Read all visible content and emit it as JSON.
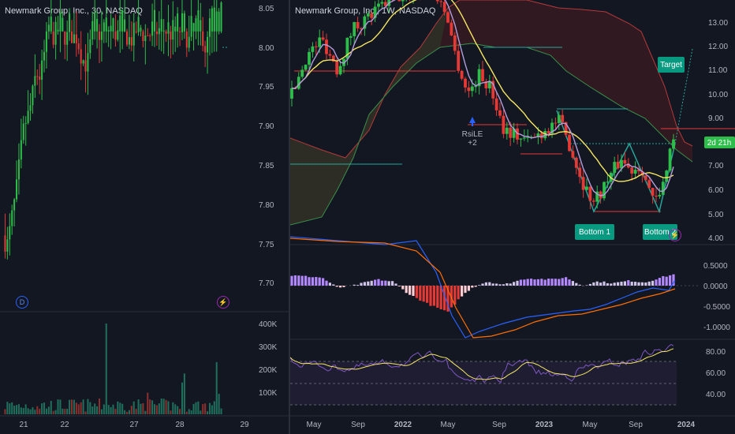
{
  "left": {
    "title": "Newmark Group, Inc., 30, NASDAQ",
    "price_ticks": [
      "8.05",
      "8.00",
      "7.95",
      "7.90",
      "7.85",
      "7.80",
      "7.75",
      "7.70"
    ],
    "volume_ticks": [
      "400K",
      "300K",
      "200K",
      "100K"
    ],
    "time_ticks": [
      "21",
      "22",
      "27",
      "28",
      "29"
    ],
    "dividend_icon": "D",
    "flash_icon": "⚡"
  },
  "right": {
    "title": "Newmark Group, Inc., 1W, NASDAQ",
    "price_ticks": [
      "13.00",
      "12.00",
      "11.00",
      "10.00",
      "9.00",
      "7.00",
      "6.00",
      "5.00",
      "4.00"
    ],
    "price_label": "2d 21h",
    "macd_ticks": [
      "0.5000",
      "0.0000",
      "-0.5000",
      "-1.0000"
    ],
    "rsi_ticks": [
      "80.00",
      "60.00",
      "40.00"
    ],
    "time_ticks": [
      "May",
      "Sep",
      "2022",
      "May",
      "Sep",
      "2023",
      "May",
      "Sep",
      "2024"
    ],
    "annotations": {
      "target": "Target",
      "bottom1": "Bottom 1",
      "bottom2": "Bottom 2",
      "rsile": "RsiLE",
      "rsile_sub": "+2"
    },
    "flash_icon": "⚡"
  },
  "colors": {
    "bg": "#131722",
    "up": "#26a69a",
    "down": "#ef5350",
    "green_candle": "#2ebd4b",
    "red_candle": "#e53935",
    "ma_yellow": "#f5e663",
    "ma_violet": "#b39ddb",
    "macd_blue": "#2962ff",
    "signal_orange": "#ff6d00",
    "badge": "#089981"
  }
}
